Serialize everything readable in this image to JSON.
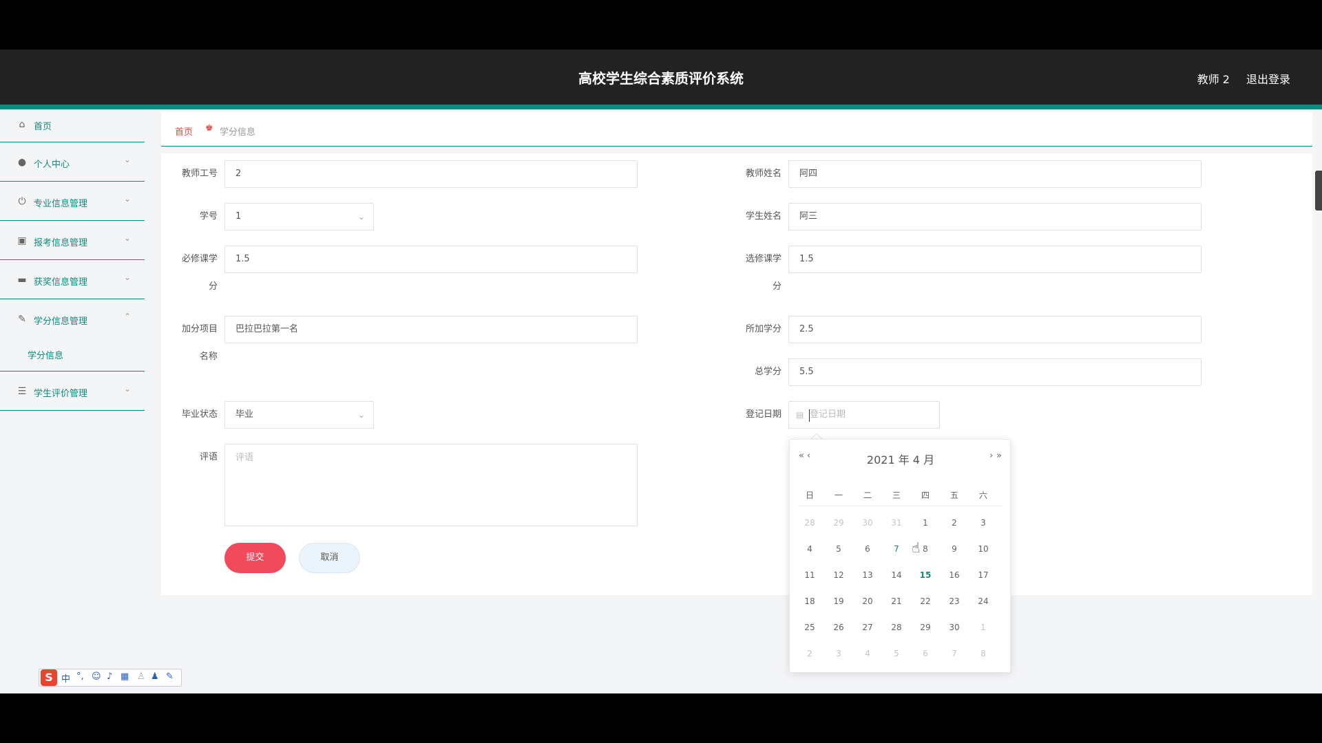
{
  "header": {
    "title": "高校学生综合素质评价系统",
    "user": "教师 2",
    "logout": "退出登录"
  },
  "sidebar": {
    "items": [
      {
        "label": "首页",
        "icon": "home-icon"
      },
      {
        "label": "个人中心",
        "icon": "user-icon"
      },
      {
        "label": "专业信息管理",
        "icon": "power-icon"
      },
      {
        "label": "报考信息管理",
        "icon": "clipboard-icon"
      },
      {
        "label": "获奖信息管理",
        "icon": "monitor-icon"
      },
      {
        "label": "学分信息管理",
        "icon": "bell-off-icon"
      },
      {
        "label": "学生评价管理",
        "icon": "sliders-icon"
      }
    ],
    "sub_item": "学分信息"
  },
  "breadcrumb": {
    "home": "首页",
    "current": "学分信息"
  },
  "form": {
    "teacher_id_label": "教师工号",
    "teacher_id_value": "2",
    "teacher_name_label": "教师姓名",
    "teacher_name_value": "阿四",
    "student_no_label": "学号",
    "student_no_value": "1",
    "student_name_label": "学生姓名",
    "student_name_value": "阿三",
    "required_credit_label_1": "必修课学",
    "required_credit_label_2": "分",
    "required_credit_value": "1.5",
    "elective_credit_label_1": "选修课学",
    "elective_credit_label_2": "分",
    "elective_credit_value": "1.5",
    "bonus_item_label_1": "加分项目",
    "bonus_item_label_2": "名称",
    "bonus_item_value": "巴拉巴拉第一名",
    "bonus_credit_label": "所加学分",
    "bonus_credit_value": "2.5",
    "total_credit_label": "总学分",
    "total_credit_value": "5.5",
    "grad_status_label": "毕业状态",
    "grad_status_value": "毕业",
    "reg_date_label": "登记日期",
    "reg_date_placeholder": "登记日期",
    "comment_label": "评语",
    "comment_placeholder": "评语",
    "submit": "提交",
    "cancel": "取消"
  },
  "datepicker": {
    "prev_year": "«",
    "prev_month": "‹",
    "next_month": "›",
    "next_year": "»",
    "heading": "2021 年  4 月",
    "weekdays": [
      "日",
      "一",
      "二",
      "三",
      "四",
      "五",
      "六"
    ],
    "weeks": [
      [
        "28",
        "29",
        "30",
        "31",
        "1",
        "2",
        "3"
      ],
      [
        "4",
        "5",
        "6",
        "7",
        "8",
        "9",
        "10"
      ],
      [
        "11",
        "12",
        "13",
        "14",
        "15",
        "16",
        "17"
      ],
      [
        "18",
        "19",
        "20",
        "21",
        "22",
        "23",
        "24"
      ],
      [
        "25",
        "26",
        "27",
        "28",
        "29",
        "30",
        "1"
      ],
      [
        "2",
        "3",
        "4",
        "5",
        "6",
        "7",
        "8"
      ]
    ],
    "muted": [
      [
        0,
        0
      ],
      [
        0,
        1
      ],
      [
        0,
        2
      ],
      [
        0,
        3
      ],
      [
        4,
        6
      ],
      [
        5,
        0
      ],
      [
        5,
        1
      ],
      [
        5,
        2
      ],
      [
        5,
        3
      ],
      [
        5,
        4
      ],
      [
        5,
        5
      ],
      [
        5,
        6
      ]
    ],
    "today": [
      2,
      4
    ],
    "hover": [
      1,
      3
    ]
  },
  "ime": {
    "logo": "S",
    "mode": "中",
    "punct": "°,",
    "icons": [
      "smile-icon",
      "mic-icon",
      "keyboard-icon",
      "person-icon",
      "shirt-icon",
      "wrench-icon"
    ]
  },
  "colors": {
    "accent": "#0f8a7e",
    "header_bg": "#222222",
    "submit": "#f04a5c",
    "breadcrumb_home": "#e2473d"
  }
}
